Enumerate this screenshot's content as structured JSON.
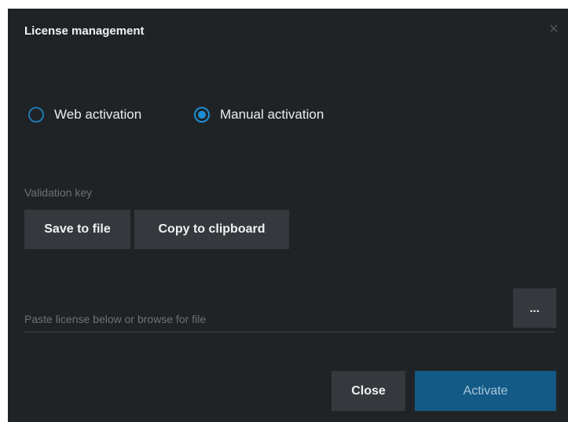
{
  "dialog": {
    "title": "License management",
    "close_icon": "close-icon"
  },
  "activation": {
    "options": [
      {
        "label": "Web activation",
        "selected": false
      },
      {
        "label": "Manual activation",
        "selected": true
      }
    ]
  },
  "validation": {
    "label": "Validation key",
    "save_label": "Save to file",
    "copy_label": "Copy to clipboard"
  },
  "license": {
    "placeholder": "Paste license below or browse for file",
    "value": "",
    "browse_label": "..."
  },
  "footer": {
    "close_label": "Close",
    "activate_label": "Activate"
  },
  "colors": {
    "background": "#202326",
    "button": "#35393d",
    "accent": "#1e8fd6",
    "primary_button": "#135a86"
  }
}
